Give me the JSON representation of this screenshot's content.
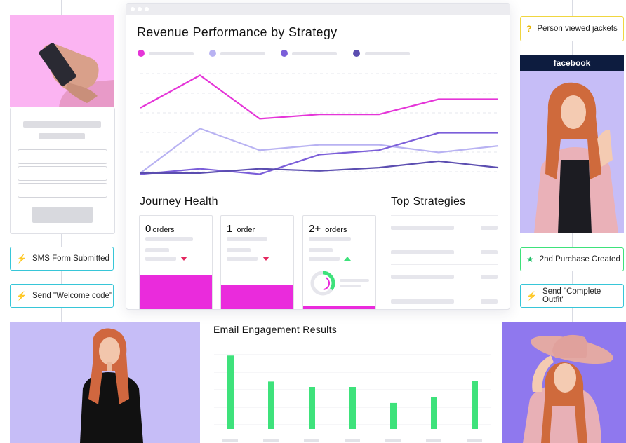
{
  "revenue_card": {
    "title": "Revenue Performance by Strategy",
    "legend": [
      {
        "color": "#e535d8"
      },
      {
        "color": "#b8b2f2"
      },
      {
        "color": "#7b5ed9"
      },
      {
        "color": "#5b4db0"
      }
    ]
  },
  "chart_data": {
    "type": "line",
    "x": [
      1,
      2,
      3,
      4,
      5,
      6,
      7
    ],
    "ylim": [
      0,
      10
    ],
    "series": [
      {
        "color": "#e535d8",
        "values": [
          6.2,
          9.2,
          5.2,
          5.6,
          5.6,
          7.0,
          7.0
        ]
      },
      {
        "color": "#b8b2f2",
        "values": [
          0.2,
          4.3,
          2.3,
          2.8,
          2.8,
          2.1,
          2.7
        ]
      },
      {
        "color": "#7b5ed9",
        "values": [
          0.1,
          0.6,
          0.1,
          1.9,
          2.3,
          3.9,
          3.9
        ]
      },
      {
        "color": "#5b4db0",
        "values": [
          0.2,
          0.2,
          0.6,
          0.4,
          0.7,
          1.3,
          0.7
        ]
      }
    ],
    "grid": true
  },
  "journey": {
    "title": "Journey Health",
    "cards": [
      {
        "count": "0",
        "unit": "orders",
        "trend": "down",
        "bar_fill": 0.95
      },
      {
        "count": "1",
        "unit": "order",
        "trend": "down",
        "bar_fill": 0.68
      },
      {
        "count": "2+",
        "unit": "orders",
        "trend": "up",
        "bar_fill": 0.0,
        "donut": 0.35
      }
    ]
  },
  "top_strategies": {
    "title": "Top Strategies"
  },
  "email_chart": {
    "title": "Email Engagement Results",
    "chart_data": {
      "type": "bar",
      "values": [
        9.6,
        6.2,
        5.5,
        5.5,
        3.4,
        4.2,
        6.3
      ],
      "ylim": [
        0,
        11
      ],
      "color": "#3ee27b"
    }
  },
  "left_flow": {
    "tag1": {
      "label": "SMS Form Submitted",
      "icon": "lightning-icon"
    },
    "tag2": {
      "label": "Send \"Welcome code\"",
      "icon": "lightning-icon"
    }
  },
  "right_flow": {
    "tag0": {
      "label": "Person viewed jackets",
      "icon": "question-icon"
    },
    "tag1": {
      "label": "2nd Purchase Created",
      "icon": "star-icon"
    },
    "tag2": {
      "label": "Send \"Complete Outfit\"",
      "icon": "lightning-icon"
    },
    "facebook_label": "facebook"
  },
  "colors": {
    "accent_magenta": "#ea2bdc",
    "accent_green": "#3ee27b",
    "tag_border_cyan": "#37c6d8",
    "tag_border_yellow": "#f0d640",
    "tag_border_green": "#3ee27b",
    "photo_bg_pink": "#fbb4f2",
    "photo_bg_lavender": "#c6bdf7",
    "photo_bg_purple": "#8f78ee"
  }
}
